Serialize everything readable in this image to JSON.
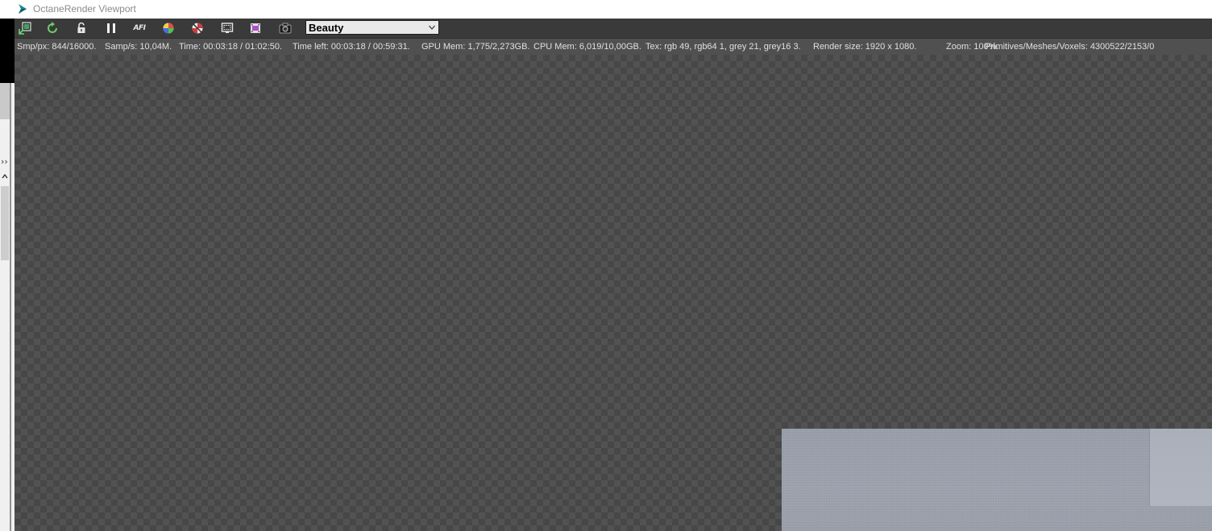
{
  "window": {
    "title": "OctaneRender Viewport"
  },
  "toolbar": {
    "buttons": [
      {
        "name": "send-scene-icon"
      },
      {
        "name": "restart-render-icon"
      },
      {
        "name": "lock-icon"
      },
      {
        "name": "pause-icon"
      },
      {
        "name": "afi-focus-icon",
        "label": "AFI"
      },
      {
        "name": "color-picker-icon"
      },
      {
        "name": "stop-render-icon"
      },
      {
        "name": "region-render-icon"
      },
      {
        "name": "film-settings-icon"
      },
      {
        "name": "save-image-icon"
      }
    ],
    "render_pass": {
      "selected": "Beauty"
    }
  },
  "stats": {
    "smp_px": "Smp/px: 844/16000.",
    "samp_s": "Samp/s: 10,04M.",
    "time": "Time: 00:03:18 / 01:02:50.",
    "time_left": "Time left: 00:03:18 / 00:59:31.",
    "gpu_mem": "GPU Mem: 1,775/2,273GB.",
    "cpu_mem": "CPU Mem: 6,019/10,00GB.",
    "tex": "Tex: rgb 49, rgb64 1, grey 21, grey16 3.",
    "render_size": "Render size: 1920 x 1080.",
    "zoom": "Zoom: 100%.",
    "primitives": "Primitives/Meshes/Voxels: 4300522/2153/0"
  },
  "sidebar": {
    "expand_glyph": "››"
  },
  "colors": {
    "toolbar_bg": "#3a3a3a",
    "stats_bg": "#505050",
    "viewport_checker_dark": "#474747",
    "viewport_checker_light": "#525252",
    "render_surface": "#9ea3ae"
  }
}
